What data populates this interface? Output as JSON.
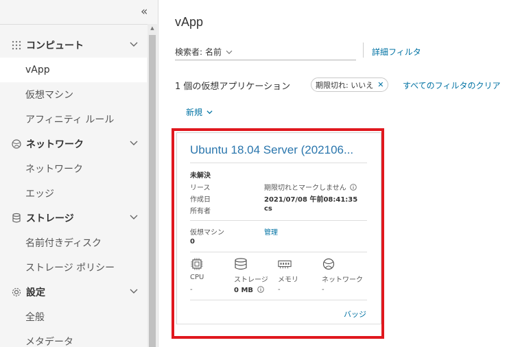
{
  "sidebar": {
    "groups": [
      {
        "label": "コンピュート",
        "icon": "compute-grid-icon",
        "items": [
          {
            "label": "vApp",
            "active": true
          },
          {
            "label": "仮想マシン",
            "active": false
          },
          {
            "label": "アフィニティ ルール",
            "active": false
          }
        ]
      },
      {
        "label": "ネットワーク",
        "icon": "network-globe-icon",
        "items": [
          {
            "label": "ネットワーク",
            "active": false
          },
          {
            "label": "エッジ",
            "active": false
          }
        ]
      },
      {
        "label": "ストレージ",
        "icon": "database-icon",
        "items": [
          {
            "label": "名前付きディスク",
            "active": false
          },
          {
            "label": "ストレージ ポリシー",
            "active": false
          }
        ]
      },
      {
        "label": "設定",
        "icon": "gear-icon",
        "items": [
          {
            "label": "全般",
            "active": false
          },
          {
            "label": "メタデータ",
            "active": false
          }
        ]
      }
    ]
  },
  "main": {
    "title": "vApp",
    "search": {
      "label": "検索者:",
      "value": "名前"
    },
    "advanced_filter": "詳細フィルタ",
    "count_text": "1 個の仮想アプリケーション",
    "filter_chip": "期限切れ: いいえ",
    "clear_filters": "すべてのフィルタのクリア",
    "new_button": "新規"
  },
  "card": {
    "title": "Ubuntu 18.04 Server (202106...",
    "status": "未解決",
    "lease_label": "リース",
    "lease_value": "期限切れとマークしません",
    "created_label": "作成日",
    "created_value": "2021/07/08 午前08:41:35",
    "owner_label": "所有者",
    "owner_value": "cs",
    "vm_label": "仮想マシン",
    "vm_count": "0",
    "manage_link": "管理",
    "resources": {
      "cpu": {
        "label": "CPU",
        "value": "-"
      },
      "storage": {
        "label": "ストレージ",
        "value": "0 MB"
      },
      "memory": {
        "label": "メモリ",
        "value": "-"
      },
      "network": {
        "label": "ネットワーク",
        "value": "-"
      }
    },
    "badge_link": "バッジ"
  },
  "colors": {
    "link": "#0072a3",
    "card_title": "#2a76ad",
    "highlight": "#e0181e",
    "sidebar_bg": "#f5f5f5"
  }
}
